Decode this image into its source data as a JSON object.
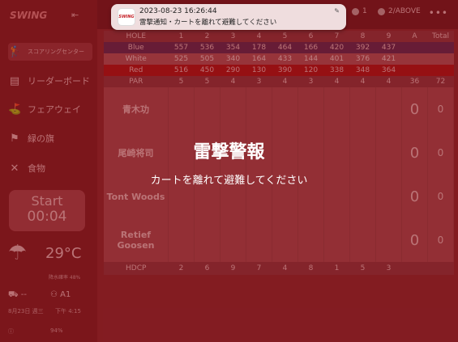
{
  "sidebar": {
    "logo": "SWING",
    "items": [
      {
        "icon": "🏌",
        "label": "スコアリングセンター"
      },
      {
        "icon": "▤",
        "label": "リーダーボード"
      },
      {
        "icon": "⛳",
        "label": "フェアウェイ"
      },
      {
        "icon": "⚑",
        "label": "緑の旗"
      },
      {
        "icon": "✕",
        "label": "食物"
      }
    ],
    "start_label": "Start",
    "timer": "00:04",
    "temperature": "29°C",
    "rain_chance": "降水確率 48%",
    "cart_label": "--",
    "group_label": "A1",
    "date": "8月23日 週三",
    "time": "下午 4:15",
    "battery": "94%"
  },
  "topbar": {
    "pill_1": "1",
    "pill_2": "2/ABOVE",
    "more": "•••"
  },
  "scorecard": {
    "header": [
      "HOLE",
      "1",
      "2",
      "3",
      "4",
      "5",
      "6",
      "7",
      "8",
      "9",
      "A",
      "Total"
    ],
    "blue": [
      "Blue",
      "557",
      "536",
      "354",
      "178",
      "464",
      "166",
      "420",
      "392",
      "437",
      "",
      ""
    ],
    "white": [
      "White",
      "525",
      "505",
      "340",
      "164",
      "433",
      "144",
      "401",
      "376",
      "421",
      "",
      ""
    ],
    "red": [
      "Red",
      "516",
      "450",
      "290",
      "130",
      "390",
      "120",
      "338",
      "348",
      "364",
      "",
      ""
    ],
    "par": [
      "PAR",
      "5",
      "5",
      "4",
      "3",
      "4",
      "3",
      "4",
      "4",
      "4",
      "36",
      "72"
    ],
    "players": [
      {
        "name": "青木功",
        "score": "0",
        "total": "0"
      },
      {
        "name": "尾崎将司",
        "score": "0",
        "total": "0"
      },
      {
        "name": "Tont Woods",
        "score": "0",
        "total": "0"
      },
      {
        "name": "Retief Goosen",
        "score": "0",
        "total": "0"
      }
    ],
    "hdcp": [
      "HDCP",
      "2",
      "6",
      "9",
      "7",
      "4",
      "8",
      "1",
      "5",
      "3",
      "",
      ""
    ]
  },
  "alert": {
    "title": "雷撃警報",
    "message": "カートを離れて避難してください"
  },
  "notification": {
    "app_icon_text": "SWING",
    "timestamp": "2023-08-23 16:26:44",
    "text": "雷撃通知・カートを離れて避難してください",
    "close_icon": "close-icon"
  }
}
